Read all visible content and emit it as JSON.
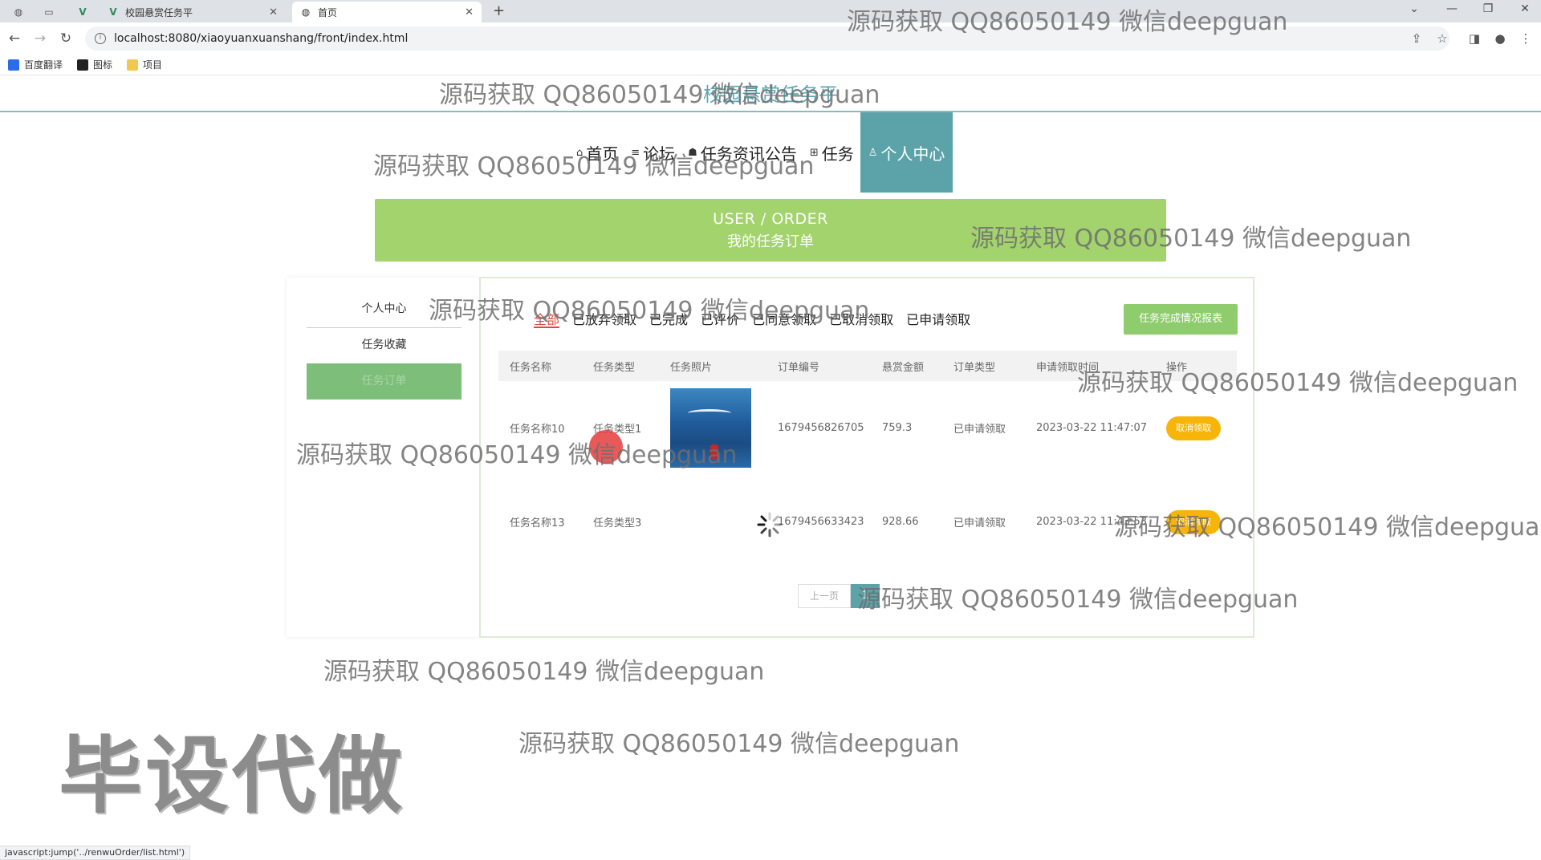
{
  "browser": {
    "tabs": [
      {
        "title": "校园悬赏任务平",
        "active": false
      },
      {
        "title": "首页",
        "active": true
      }
    ],
    "new_tab_symbol": "+",
    "url": "localhost:8080/xiaoyuanxuanshang/front/index.html",
    "bookmarks": [
      {
        "label": "百度翻译",
        "color": "#2b6de8"
      },
      {
        "label": "图标",
        "color": "#222222"
      },
      {
        "label": "项目",
        "color": "#f2c94c"
      }
    ],
    "status_url": "javascript:jump('../renwuOrder/list.html')"
  },
  "site": {
    "title": "校园悬赏任务平",
    "nav": [
      {
        "label": "首页",
        "icon": "home-icon",
        "glyph": "⌂",
        "active": false
      },
      {
        "label": "论坛",
        "icon": "forum-icon",
        "glyph": "≡",
        "active": false
      },
      {
        "label": "任务资讯公告",
        "icon": "mortarboard-icon",
        "glyph": "☗",
        "active": false
      },
      {
        "label": "任务",
        "icon": "grid-icon",
        "glyph": "⊞",
        "active": false
      },
      {
        "label": "个人中心",
        "icon": "user-icon",
        "glyph": "♙",
        "active": true
      }
    ]
  },
  "banner": {
    "en": "USER / ORDER",
    "cn": "我的任务订单"
  },
  "sidebar": {
    "items": [
      {
        "label": "个人中心",
        "active": false
      },
      {
        "label": "任务收藏",
        "active": false
      },
      {
        "label": "任务订单",
        "active": true
      }
    ]
  },
  "orders": {
    "status_tabs": [
      "全部",
      "已放弃领取",
      "已完成",
      "已评价",
      "已同意领取",
      "已取消领取",
      "已申请领取"
    ],
    "active_tab": "全部",
    "report_button": "任务完成情况报表",
    "columns": [
      "任务名称",
      "任务类型",
      "任务照片",
      "订单编号",
      "悬赏金额",
      "订单类型",
      "申请领取时间",
      "操作"
    ],
    "rows": [
      {
        "name": "任务名称10",
        "type": "任务类型1",
        "has_photo": true,
        "order_no": "1679456826705",
        "amount": "759.3",
        "order_type": "已申请领取",
        "time": "2023-03-22 11:47:07",
        "action": "取消领取"
      },
      {
        "name": "任务名称13",
        "type": "任务类型3",
        "has_photo": false,
        "order_no": "1679456633423",
        "amount": "928.66",
        "order_type": "已申请领取",
        "time": "2023-03-22 11:43:53",
        "action": "取消领取"
      }
    ],
    "pager": {
      "prev": "上一页",
      "current": "1"
    }
  },
  "watermarks": {
    "repeated": "源码获取 QQ86050149 微信deepguan",
    "big": "毕设代做"
  },
  "colors": {
    "accent_teal": "#5ba3a8",
    "banner_green": "#a3d36d",
    "action_orange": "#f7b50a",
    "active_tab_red": "#e04b3c"
  }
}
